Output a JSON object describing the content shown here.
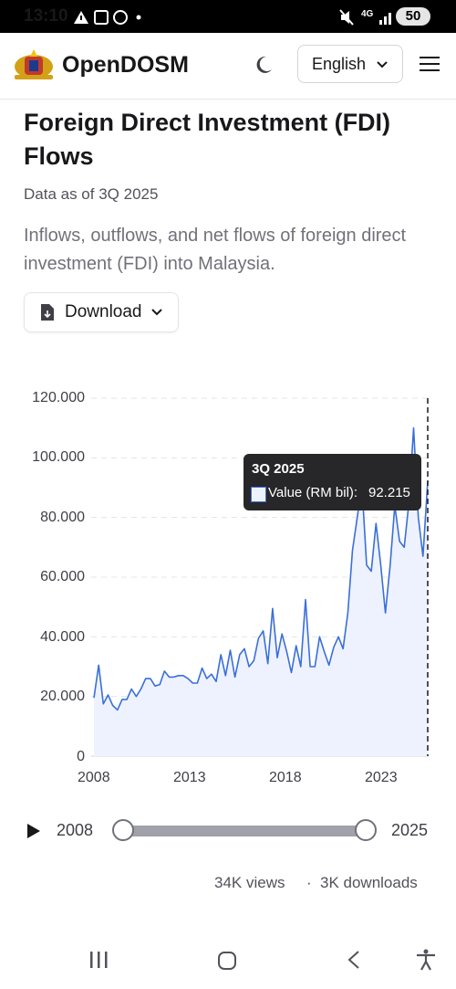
{
  "status_bar": {
    "time": "13:10",
    "network": "4G",
    "battery": "50"
  },
  "header": {
    "brand": "OpenDOSM",
    "language": "English"
  },
  "page": {
    "title": "Foreign Direct Investment (FDI) Flows",
    "data_as_of": "Data as of 3Q 2025",
    "description": "Inflows, outflows, and net flows of foreign direct investment (FDI) into Malaysia.",
    "download_label": "Download"
  },
  "tooltip": {
    "title": "3Q 2025",
    "series_label": "Value (RM bil):",
    "value": "92.215"
  },
  "slider": {
    "start": "2008",
    "end": "2025"
  },
  "footer": {
    "views": "34K views",
    "separator": "·",
    "downloads": "3K downloads"
  },
  "colors": {
    "line": "#3b6fd6",
    "fill": "#eef2ff",
    "grid": "#e4e4e7"
  },
  "chart_data": {
    "type": "area",
    "x_unit": "quarter",
    "y_tick_labels": [
      "0",
      "20.000",
      "40.000",
      "60.000",
      "80.000",
      "100.000",
      "120.000"
    ],
    "y_ticks": [
      0,
      20,
      40,
      60,
      80,
      100,
      120
    ],
    "x_tick_labels": [
      "2008",
      "2013",
      "2018",
      "2023"
    ],
    "ylim": [
      0,
      120
    ],
    "x_start": "1Q 2008",
    "x_end": "3Q 2025",
    "grid": true,
    "series": [
      {
        "values": [
          19.5,
          30.5,
          17.5,
          20.5,
          17,
          15.5,
          19,
          19,
          22.5,
          20,
          22.5,
          26,
          26,
          23.5,
          24,
          28.5,
          26.5,
          26.5,
          27,
          27,
          26,
          24.5,
          24.5,
          29.5,
          26,
          27.5,
          25,
          34,
          27,
          35.5,
          26.5,
          34,
          36,
          30,
          32,
          39.5,
          42,
          31,
          49.5,
          33,
          41,
          35,
          28,
          37,
          30,
          52.5,
          30,
          30,
          40,
          35,
          30.5,
          36.5,
          40,
          36,
          48,
          69,
          80,
          91,
          64,
          62,
          78,
          64,
          48,
          64,
          84,
          72,
          70,
          85,
          110,
          80,
          67,
          92.2
        ]
      }
    ]
  }
}
